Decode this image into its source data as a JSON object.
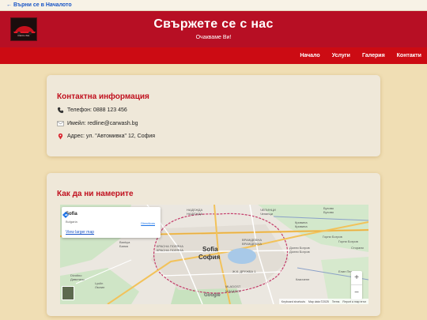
{
  "back_link": "← Върни се в Началото",
  "header": {
    "title": "Свържете се с нас",
    "subtitle": "Очакваме Ви!",
    "logo_text": "REDLINE"
  },
  "nav": [
    "Начало",
    "Услуги",
    "Галерия",
    "Контакти"
  ],
  "contact": {
    "heading": "Контактна информация",
    "phone": "Телефон: 0888 123 456",
    "email": "Имейл: redline@carwash.bg",
    "address": "Адрес: ул. \"Автомивка\" 12, София"
  },
  "map_section": {
    "heading": "Как да ни намерите",
    "place_name": "Sofia",
    "country": "Bulgaria",
    "directions": "Directions",
    "view_larger": "View larger map",
    "city_latin": "Sofia",
    "city_cyrillic": "София",
    "attribution": [
      "Keyboard shortcuts",
      "Map data ©2025",
      "Terms",
      "Report a map error"
    ],
    "labels": [
      "НАДЕЖДА",
      "НАДЕЖДА",
      "ЧЕПИНЦИ",
      "Чепинци",
      "Бухово",
      "Бухово",
      "Кривина",
      "Кривина",
      "ВРАЖДЕБНА",
      "ВРАЖДЕБНА",
      "Долни Богров",
      "Долни Богров",
      "Горни Богров",
      "КРАСНА ПОЛЯНА",
      "КРАСНА ПОЛЯНА",
      "Ж.К. ДРУЖБА 1",
      "Bankya",
      "Банкя",
      "Divotino",
      "Дивотино",
      "Lyulin",
      "Люлин",
      "MLADOST",
      "МЛАДОСТ",
      "Казичене",
      "Елин Пелин",
      "Горни Богров",
      "Сторани"
    ],
    "zoom_in": "+",
    "zoom_out": "−",
    "google": "Google"
  }
}
